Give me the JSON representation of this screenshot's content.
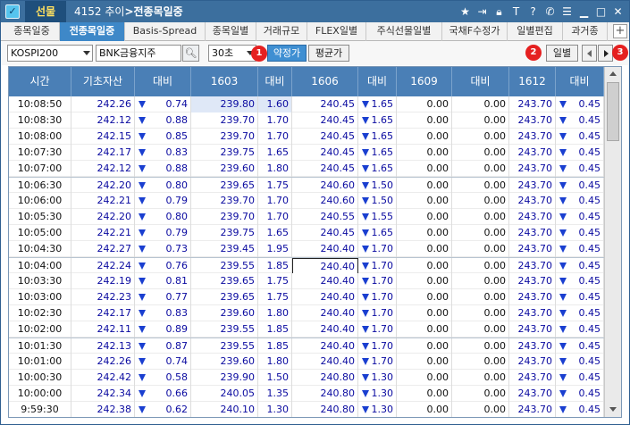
{
  "window": {
    "brand": "선물",
    "screen_no": "4152 추이",
    "title": "전종목일중"
  },
  "tabs": [
    {
      "label": "종목일중",
      "active": false
    },
    {
      "label": "전종목일중",
      "active": true
    },
    {
      "label": "Basis-Spread",
      "active": false
    },
    {
      "label": "종목일별",
      "active": false
    },
    {
      "label": "거래규모",
      "active": false
    },
    {
      "label": "FLEX일별",
      "active": false
    },
    {
      "label": "주식선물일별",
      "active": false
    },
    {
      "label": "국채F수정가",
      "active": false
    },
    {
      "label": "일별편집",
      "active": false
    },
    {
      "label": "과거종",
      "active": false
    }
  ],
  "tab_more": "+",
  "toolbar": {
    "market": "KOSPI200",
    "sector": "BNK금융지주",
    "interval": "30초",
    "btn_trade": "약정가",
    "btn_avg": "평균가",
    "btn_daily": "일별",
    "badge1": "1",
    "badge2": "2",
    "badge3": "3"
  },
  "columns": [
    "시간",
    "기초자산",
    "대비",
    "1603",
    "대비",
    "1606",
    "대비",
    "1609",
    "대비",
    "1612",
    "대비"
  ],
  "rows": [
    [
      "10:08:50",
      "242.26",
      "0.74",
      "239.80",
      "1.60",
      "240.45",
      "1.65",
      "0.00",
      "0.00",
      "243.70",
      "0.45"
    ],
    [
      "10:08:30",
      "242.12",
      "0.88",
      "239.70",
      "1.70",
      "240.45",
      "1.65",
      "0.00",
      "0.00",
      "243.70",
      "0.45"
    ],
    [
      "10:08:00",
      "242.15",
      "0.85",
      "239.70",
      "1.70",
      "240.45",
      "1.65",
      "0.00",
      "0.00",
      "243.70",
      "0.45"
    ],
    [
      "10:07:30",
      "242.17",
      "0.83",
      "239.75",
      "1.65",
      "240.45",
      "1.65",
      "0.00",
      "0.00",
      "243.70",
      "0.45"
    ],
    [
      "10:07:00",
      "242.12",
      "0.88",
      "239.60",
      "1.80",
      "240.45",
      "1.65",
      "0.00",
      "0.00",
      "243.70",
      "0.45"
    ],
    [
      "10:06:30",
      "242.20",
      "0.80",
      "239.65",
      "1.75",
      "240.60",
      "1.50",
      "0.00",
      "0.00",
      "243.70",
      "0.45"
    ],
    [
      "10:06:00",
      "242.21",
      "0.79",
      "239.70",
      "1.70",
      "240.60",
      "1.50",
      "0.00",
      "0.00",
      "243.70",
      "0.45"
    ],
    [
      "10:05:30",
      "242.20",
      "0.80",
      "239.70",
      "1.70",
      "240.55",
      "1.55",
      "0.00",
      "0.00",
      "243.70",
      "0.45"
    ],
    [
      "10:05:00",
      "242.21",
      "0.79",
      "239.75",
      "1.65",
      "240.45",
      "1.65",
      "0.00",
      "0.00",
      "243.70",
      "0.45"
    ],
    [
      "10:04:30",
      "242.27",
      "0.73",
      "239.45",
      "1.95",
      "240.40",
      "1.70",
      "0.00",
      "0.00",
      "243.70",
      "0.45"
    ],
    [
      "10:04:00",
      "242.24",
      "0.76",
      "239.55",
      "1.85",
      "240.40",
      "1.70",
      "0.00",
      "0.00",
      "243.70",
      "0.45"
    ],
    [
      "10:03:30",
      "242.19",
      "0.81",
      "239.65",
      "1.75",
      "240.40",
      "1.70",
      "0.00",
      "0.00",
      "243.70",
      "0.45"
    ],
    [
      "10:03:00",
      "242.23",
      "0.77",
      "239.65",
      "1.75",
      "240.40",
      "1.70",
      "0.00",
      "0.00",
      "243.70",
      "0.45"
    ],
    [
      "10:02:30",
      "242.17",
      "0.83",
      "239.60",
      "1.80",
      "240.40",
      "1.70",
      "0.00",
      "0.00",
      "243.70",
      "0.45"
    ],
    [
      "10:02:00",
      "242.11",
      "0.89",
      "239.55",
      "1.85",
      "240.40",
      "1.70",
      "0.00",
      "0.00",
      "243.70",
      "0.45"
    ],
    [
      "10:01:30",
      "242.13",
      "0.87",
      "239.55",
      "1.85",
      "240.40",
      "1.70",
      "0.00",
      "0.00",
      "243.70",
      "0.45"
    ],
    [
      "10:01:00",
      "242.26",
      "0.74",
      "239.60",
      "1.80",
      "240.40",
      "1.70",
      "0.00",
      "0.00",
      "243.70",
      "0.45"
    ],
    [
      "10:00:30",
      "242.42",
      "0.58",
      "239.90",
      "1.50",
      "240.80",
      "1.30",
      "0.00",
      "0.00",
      "243.70",
      "0.45"
    ],
    [
      "10:00:00",
      "242.34",
      "0.66",
      "240.05",
      "1.35",
      "240.80",
      "1.30",
      "0.00",
      "0.00",
      "243.70",
      "0.45"
    ],
    [
      "9:59:30",
      "242.38",
      "0.62",
      "240.10",
      "1.30",
      "240.80",
      "1.30",
      "0.00",
      "0.00",
      "243.70",
      "0.45"
    ]
  ],
  "icons": [
    "star-icon",
    "export-icon",
    "lock-icon",
    "text-icon",
    "help-icon",
    "phone-icon",
    "list-icon",
    "minimize-icon",
    "maximize-icon",
    "close-icon"
  ]
}
